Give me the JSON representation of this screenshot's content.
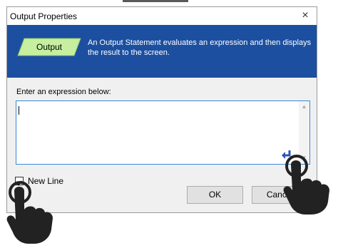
{
  "dialog": {
    "title": "Output Properties",
    "close_glyph": "×"
  },
  "banner": {
    "shape_label": "Output",
    "description": "An Output Statement evaluates an expression and then displays the result to the screen.",
    "background_color": "#1c4fa0",
    "shape_color": "#c6ef9f"
  },
  "expression": {
    "label": "Enter an expression below:",
    "value": ""
  },
  "new_line": {
    "label": "New Line",
    "checked": true
  },
  "buttons": {
    "ok": "OK",
    "cancel": "Cancel"
  },
  "icons": {
    "enter": "enter-return-icon",
    "pointer": "pointing-hand-icon"
  }
}
